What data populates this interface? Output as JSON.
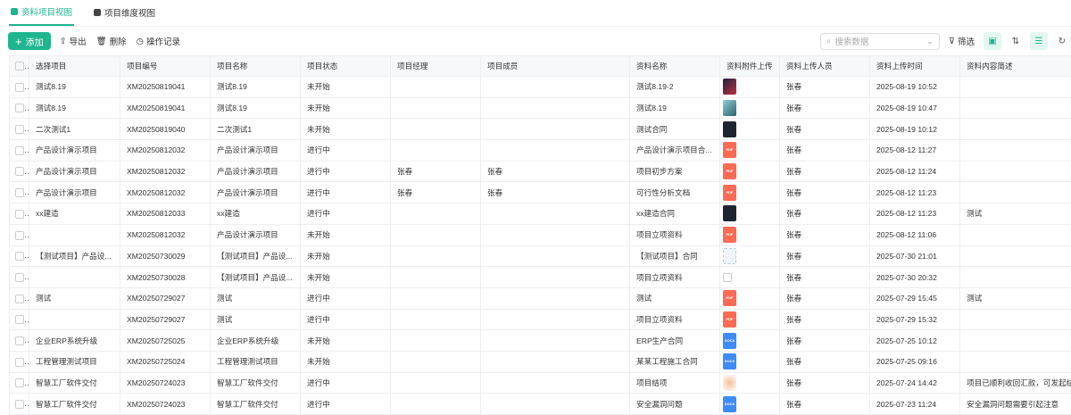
{
  "tabs": [
    {
      "label": "资料项目视图",
      "active": true
    },
    {
      "label": "项目维度视图",
      "active": false
    }
  ],
  "toolbar": {
    "add": "添加",
    "export": "导出",
    "delete": "删除",
    "log": "操作记录",
    "search_placeholder": "搜索数据",
    "filter": "筛选"
  },
  "accent": "#1fb58f",
  "columns": [
    "选择项目",
    "项目编号",
    "项目名称",
    "项目状态",
    "项目经理",
    "项目成员",
    "资料名称",
    "资料附件上传",
    "资料上传人员",
    "资料上传时间",
    "资料内容简述"
  ],
  "rows": [
    [
      "测试8.19",
      "XM20250819041",
      "测试8.19",
      "未开始",
      "",
      "",
      "测试8.19-2",
      "photo1",
      "张春",
      "2025-08-19 10:52",
      ""
    ],
    [
      "测试8.19",
      "XM20250819041",
      "测试8.19",
      "未开始",
      "",
      "",
      "测试8.19",
      "photo2",
      "张春",
      "2025-08-19 10:47",
      ""
    ],
    [
      "二次测试1",
      "XM20250819040",
      "二次测试1",
      "未开始",
      "",
      "",
      "测试合同",
      "dark",
      "张春",
      "2025-08-19 10:12",
      ""
    ],
    [
      "产品设计演示项目",
      "XM20250812032",
      "产品设计演示项目",
      "进行中",
      "",
      "",
      "产品设计演示项目合...",
      "pdf",
      "张春",
      "2025-08-12 11:27",
      ""
    ],
    [
      "产品设计演示项目",
      "XM20250812032",
      "产品设计演示项目",
      "进行中",
      "张春",
      "张春",
      "项目初步方案",
      "pdf",
      "张春",
      "2025-08-12 11:24",
      ""
    ],
    [
      "产品设计演示项目",
      "XM20250812032",
      "产品设计演示项目",
      "进行中",
      "张春",
      "张春",
      "可行性分析文档",
      "pdf",
      "张春",
      "2025-08-12 11:23",
      ""
    ],
    [
      "xx建造",
      "XM20250812033",
      "xx建造",
      "进行中",
      "",
      "",
      "xx建造合同",
      "dark",
      "张春",
      "2025-08-12 11:23",
      "测试"
    ],
    [
      "",
      "XM20250812032",
      "产品设计演示项目",
      "未开始",
      "",
      "",
      "项目立项资料",
      "pdf",
      "张春",
      "2025-08-12 11:06",
      ""
    ],
    [
      "【测试项目】产品设...",
      "XM20250730029",
      "【测试项目】产品设...",
      "未开始",
      "",
      "",
      "【测试项目】合同",
      "light",
      "张春",
      "2025-07-30 21:01",
      ""
    ],
    [
      "",
      "XM20250730028",
      "【测试项目】产品设...",
      "未开始",
      "",
      "",
      "项目立项资料",
      "broken",
      "张春",
      "2025-07-30 20:32",
      ""
    ],
    [
      "测试",
      "XM20250729027",
      "测试",
      "进行中",
      "",
      "",
      "测试",
      "pdf",
      "张春",
      "2025-07-29 15:45",
      "测试"
    ],
    [
      "",
      "XM20250729027",
      "测试",
      "进行中",
      "",
      "",
      "项目立项资料",
      "pdf",
      "张春",
      "2025-07-29 15:32",
      ""
    ],
    [
      "企业ERP系统升级",
      "XM20250725025",
      "企业ERP系统升级",
      "未开始",
      "",
      "",
      "ERP生产合同",
      "docx",
      "张春",
      "2025-07-25 10:12",
      ""
    ],
    [
      "工程管理测试项目",
      "XM20250725024",
      "工程管理测试项目",
      "未开始",
      "",
      "",
      "某某工程施工合同",
      "docx",
      "张春",
      "2025-07-25 09:16",
      ""
    ],
    [
      "智慧工厂软件交付",
      "XM20250724023",
      "智慧工厂软件交付",
      "进行中",
      "",
      "",
      "项目结项",
      "peach",
      "张春",
      "2025-07-24 14:42",
      "项目已顺利收回汇款，可发起结项"
    ],
    [
      "智慧工厂软件交付",
      "XM20250724023",
      "智慧工厂软件交付",
      "进行中",
      "",
      "",
      "安全漏洞问题",
      "docx",
      "张春",
      "2025-07-23 11:24",
      "安全漏洞问题需要引起注意"
    ]
  ]
}
